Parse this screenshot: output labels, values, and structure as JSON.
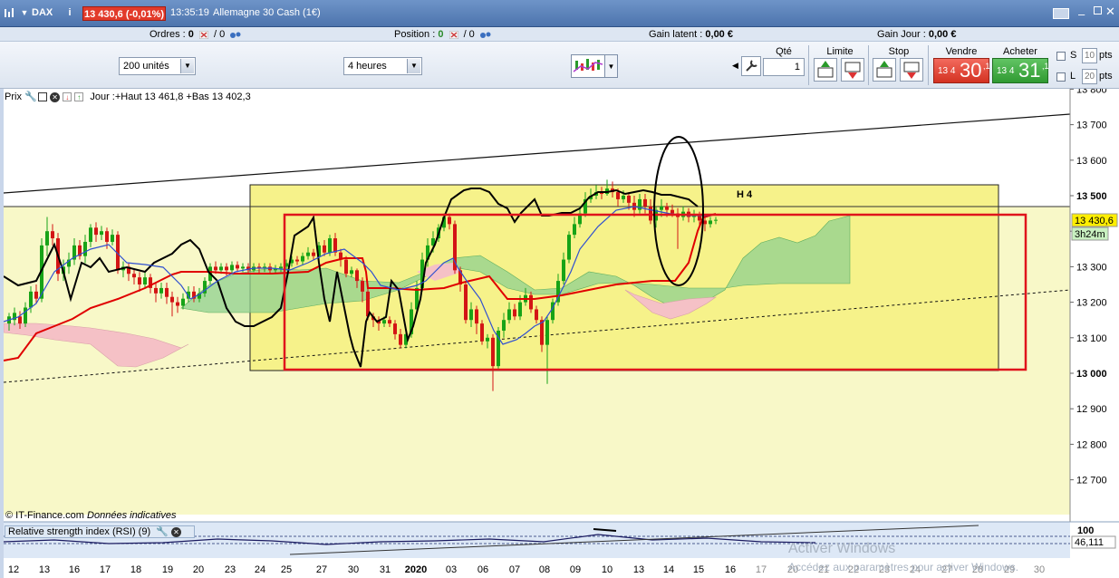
{
  "titlebar": {
    "instrument": "DAX",
    "price_change": "13 430,6 (-0,01%)",
    "time": "13:35:19",
    "description": "Allemagne 30 Cash (1€)"
  },
  "inforow": {
    "orders_label": "Ordres :",
    "orders_value": "0",
    "orders_sep": "/ 0",
    "position_label": "Position :",
    "position_value": "0",
    "position_sep": "/ 0",
    "gain_latent_label": "Gain latent :",
    "gain_latent_value": "0,00 €",
    "gain_jour_label": "Gain Jour :",
    "gain_jour_value": "0,00 €"
  },
  "toolbar": {
    "units_selected": "200 unités",
    "period_selected": "4 heures",
    "qty_label": "Qté",
    "qty_value": "1",
    "limit_label": "Limite",
    "stop_label": "Stop",
    "sell_label": "Vendre",
    "buy_label": "Acheter",
    "sell_small": "13 4",
    "sell_big": "30",
    "sell_sup": ",1",
    "buy_small": "13 4",
    "buy_big": "31",
    "buy_sup": ",1",
    "s_label": "S",
    "l_label": "L",
    "s_pts": "10",
    "l_pts": "20",
    "pts_label": "pts"
  },
  "chart": {
    "legend_name": "Prix",
    "legend_info": "Jour :+Haut 13 461,8 +Bas 13 402,3",
    "box_label": "H 4",
    "y_ticks": [
      "13 800",
      "13 700",
      "13 600",
      "13 500",
      "13 400",
      "13 300",
      "13 200",
      "13 100",
      "13 000",
      "12 900",
      "12 800",
      "12 700"
    ],
    "bold_ticks": [
      "13 500",
      "13 000"
    ],
    "last_price": "13 430,6",
    "countdown": "3h24m",
    "x_ticks": [
      "12",
      "13",
      "16",
      "17",
      "18",
      "19",
      "20",
      "23",
      "24",
      "25",
      "27",
      "30",
      "31",
      "2020",
      "03",
      "06",
      "07",
      "08",
      "09",
      "10",
      "13",
      "14",
      "15",
      "16",
      "17",
      "20",
      "21",
      "22",
      "23",
      "24",
      "27",
      "28",
      "29",
      "30"
    ],
    "watermark": "© IT-Finance.com",
    "watermark_italic": "Données indicatives",
    "rsi_label": "Relative strength index (RSI) (9)",
    "rsi_top": "100",
    "rsi_value": "46,111",
    "activate_line1": "Activer Windows",
    "activate_line2": "Accédez aux paramètres pour activer Windows."
  },
  "colors": {
    "title_bg": "#5a80b8",
    "sell": "#d9392a",
    "buy": "#34a038",
    "tenkan": "#e00000",
    "kijun_line": "#000000",
    "box_fill": "#f7f37a",
    "cloud_green": "#8fd08f",
    "cloud_pink": "#f5c1c6"
  }
}
